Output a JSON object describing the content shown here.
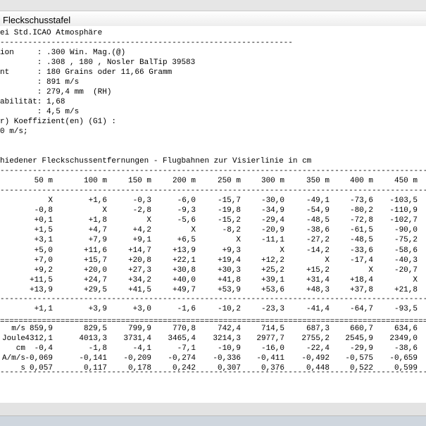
{
  "window": {
    "title": "Fleckschusstafel"
  },
  "header": {
    "lines": [
      "ei Std.ICAO Atmosphäre",
      "---------------------------------------------------------------",
      "ion     : .300 Win. Mag.(@)",
      "        : .308 , 180 , Nosler BalTip 39583",
      "nt      : 180 Grains oder 11,66 Gramm",
      "        : 891 m/s",
      "        : 279,4 mm  (RH)",
      "abilität: 1,68",
      "        : 4,5 m/s",
      "r) Koeffizient(en) (G1) :",
      "0 m/s;"
    ]
  },
  "section_title": "hiedener Fleckschussentfernungen - Flugbahnen zur Visierlinie in cm",
  "table": {
    "columns": [
      "50 m",
      "100 m",
      "150 m",
      "200 m",
      "250 m",
      "300 m",
      "350 m",
      "400 m",
      "450 m"
    ],
    "rows": [
      [
        "X",
        "+1,6",
        "-0,3",
        "-6,0",
        "-15,7",
        "-30,0",
        "-49,1",
        "-73,6",
        "-103,5"
      ],
      [
        "-0,8",
        "X",
        "-2,8",
        "-9,3",
        "-19,8",
        "-34,9",
        "-54,9",
        "-80,2",
        "-110,9"
      ],
      [
        "+0,1",
        "+1,8",
        "X",
        "-5,6",
        "-15,2",
        "-29,4",
        "-48,5",
        "-72,8",
        "-102,7"
      ],
      [
        "+1,5",
        "+4,7",
        "+4,2",
        "X",
        "-8,2",
        "-20,9",
        "-38,6",
        "-61,5",
        "-90,0"
      ],
      [
        "+3,1",
        "+7,9",
        "+9,1",
        "+6,5",
        "X",
        "-11,1",
        "-27,2",
        "-48,5",
        "-75,2"
      ],
      [
        "+5,0",
        "+11,6",
        "+14,7",
        "+13,9",
        "+9,3",
        "X",
        "-14,2",
        "-33,6",
        "-58,6"
      ],
      [
        "+7,0",
        "+15,7",
        "+20,8",
        "+22,1",
        "+19,4",
        "+12,2",
        "X",
        "-17,4",
        "-40,3"
      ],
      [
        "+9,2",
        "+20,0",
        "+27,3",
        "+30,8",
        "+30,3",
        "+25,2",
        "+15,2",
        "X",
        "-20,7"
      ],
      [
        "+11,5",
        "+24,7",
        "+34,2",
        "+40,0",
        "+41,8",
        "+39,1",
        "+31,4",
        "+18,4",
        "X"
      ],
      [
        "+13,9",
        "+29,5",
        "+41,5",
        "+49,7",
        "+53,9",
        "+53,6",
        "+48,3",
        "+37,8",
        "+21,8"
      ]
    ],
    "summary_row": [
      "+1,1",
      "+3,9",
      "+3,0",
      "-1,6",
      "-10,2",
      "-23,3",
      "-41,4",
      "-64,7",
      "-93,5"
    ],
    "stats": [
      {
        "label": "m/s",
        "values": [
          "859,9",
          "829,5",
          "799,9",
          "770,8",
          "742,4",
          "714,5",
          "687,3",
          "660,7",
          "634,6"
        ]
      },
      {
        "label": "Joule",
        "values": [
          "4312,1",
          "4013,3",
          "3731,4",
          "3465,4",
          "3214,3",
          "2977,7",
          "2755,2",
          "2545,9",
          "2349,0"
        ]
      },
      {
        "label": "cm",
        "values": [
          "-0,4",
          "-1,8",
          "-4,1",
          "-7,1",
          "-10,9",
          "-16,0",
          "-22,4",
          "-29,9",
          "-38,6"
        ]
      },
      {
        "label": "A/m/s",
        "values": [
          "-0,069",
          "-0,141",
          "-0,209",
          "-0,274",
          "-0,336",
          "-0,411",
          "-0,492",
          "-0,575",
          "-0,659"
        ]
      },
      {
        "label": "s",
        "values": [
          "0,057",
          "0,117",
          "0,178",
          "0,242",
          "0,307",
          "0,376",
          "0,448",
          "0,522",
          "0,599"
        ]
      }
    ]
  },
  "rules": {
    "dashes": "------------------------------------------------------------------------------------------------",
    "equals": "================================================================================================"
  }
}
